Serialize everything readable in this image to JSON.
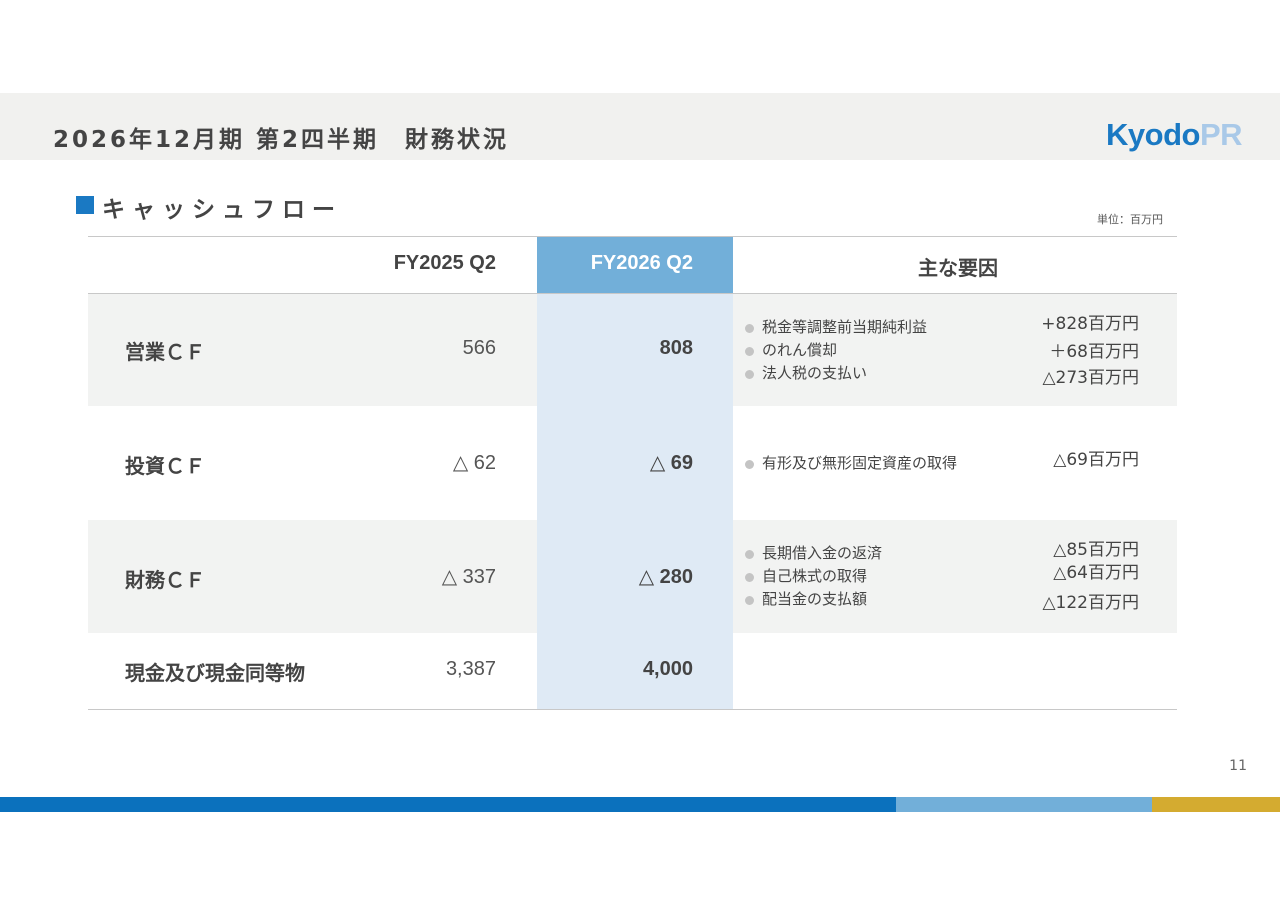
{
  "header": {
    "title": "2026年12月期 第2四半期　財務状況",
    "logo_kyodo": "Kyodo",
    "logo_pr": "PR"
  },
  "section": {
    "title": "キャッシュフロー",
    "unit_note": "単位：百万円"
  },
  "table": {
    "columns": [
      "",
      "FY2025 Q2",
      "FY2026 Q2",
      "主な要因"
    ],
    "rows": [
      {
        "label": "営業ＣＦ",
        "prev": "566",
        "cur": "808",
        "factors": [
          {
            "text": "税金等調整前当期純利益",
            "amount": "+828百万円"
          },
          {
            "text": "のれん償却",
            "amount": "＋68百万円"
          },
          {
            "text": "法人税の支払い",
            "amount": "△273百万円"
          }
        ]
      },
      {
        "label": "投資ＣＦ",
        "prev": "△ 62",
        "cur": "△ 69",
        "factors": [
          {
            "text": "有形及び無形固定資産の取得",
            "amount": "△69百万円"
          }
        ]
      },
      {
        "label": "財務ＣＦ",
        "prev": "△ 337",
        "cur": "△ 280",
        "factors": [
          {
            "text": "長期借入金の返済",
            "amount": "△85百万円"
          },
          {
            "text": "自己株式の取得",
            "amount": "△64百万円"
          },
          {
            "text": "配当金の支払額",
            "amount": "△122百万円"
          }
        ]
      },
      {
        "label": "現金及び現金同等物",
        "prev": "3,387",
        "cur": "4,000",
        "factors": []
      }
    ]
  },
  "page_number": "11",
  "colors": {
    "accent_blue": "#0b71bd",
    "light_blue": "#72afd9",
    "gold": "#d4ab30",
    "highlight_column": "#dfeaf5",
    "row_shade": "#f2f3f2"
  }
}
